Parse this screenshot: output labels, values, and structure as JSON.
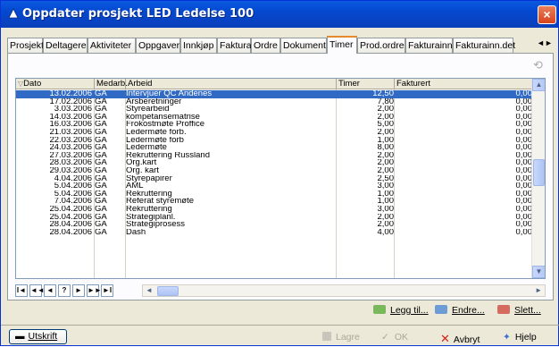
{
  "window": {
    "title": "Oppdater prosjekt LED Ledelse 100",
    "close_label": "×"
  },
  "tabs": [
    {
      "label": "Prosjekt"
    },
    {
      "label": "Deltagere"
    },
    {
      "label": "Aktiviteter"
    },
    {
      "label": "Oppgaver"
    },
    {
      "label": "Innkjøp"
    },
    {
      "label": "Faktura"
    },
    {
      "label": "Ordre"
    },
    {
      "label": "Dokument"
    },
    {
      "label": "Timer"
    },
    {
      "label": "Prod.ordre"
    },
    {
      "label": "Fakturainn"
    },
    {
      "label": "Fakturainn.det"
    }
  ],
  "active_tab": "Timer",
  "tab_nav": {
    "prev": "◄",
    "next": "►"
  },
  "grid": {
    "headers": {
      "dato": "Dato",
      "medarb": "Medarb.",
      "arbeid": "Arbeid",
      "timer": "Timer",
      "fakturert": "Fakturert"
    },
    "rows": [
      {
        "dato": "13.02.2006",
        "medarb": "GA",
        "arbeid": "Intervjuer QC Andenes",
        "timer": "12,50",
        "fakturert": "0,00",
        "selected": true
      },
      {
        "dato": "17.02.2006",
        "medarb": "GA",
        "arbeid": "Årsberetninger",
        "timer": "7,80",
        "fakturert": "0,00"
      },
      {
        "dato": "3.03.2006",
        "medarb": "GA",
        "arbeid": "Styrearbeid",
        "timer": "2,00",
        "fakturert": "0,00"
      },
      {
        "dato": "14.03.2006",
        "medarb": "GA",
        "arbeid": "kompetansematrise",
        "timer": "2,00",
        "fakturert": "0,00"
      },
      {
        "dato": "16.03.2006",
        "medarb": "GA",
        "arbeid": "Frokostmøte Proffice",
        "timer": "5,00",
        "fakturert": "0,00"
      },
      {
        "dato": "21.03.2006",
        "medarb": "GA",
        "arbeid": "Ledermøte forb.",
        "timer": "2,00",
        "fakturert": "0,00"
      },
      {
        "dato": "22.03.2006",
        "medarb": "GA",
        "arbeid": "Ledermøte forb",
        "timer": "1,00",
        "fakturert": "0,00"
      },
      {
        "dato": "24.03.2006",
        "medarb": "GA",
        "arbeid": "Ledermøte",
        "timer": "8,00",
        "fakturert": "0,00"
      },
      {
        "dato": "27.03.2006",
        "medarb": "GA",
        "arbeid": "Rekruttering Russland",
        "timer": "2,00",
        "fakturert": "0,00"
      },
      {
        "dato": "28.03.2006",
        "medarb": "GA",
        "arbeid": "Org.kart",
        "timer": "2,00",
        "fakturert": "0,00"
      },
      {
        "dato": "29.03.2006",
        "medarb": "GA",
        "arbeid": "Org. kart",
        "timer": "2,00",
        "fakturert": "0,00"
      },
      {
        "dato": "4.04.2006",
        "medarb": "GA",
        "arbeid": "Styrepapirer",
        "timer": "2,50",
        "fakturert": "0,00"
      },
      {
        "dato": "5.04.2006",
        "medarb": "GA",
        "arbeid": "AML",
        "timer": "3,00",
        "fakturert": "0,00"
      },
      {
        "dato": "5.04.2006",
        "medarb": "GA",
        "arbeid": "Rekruttering",
        "timer": "1,00",
        "fakturert": "0,00"
      },
      {
        "dato": "7.04.2006",
        "medarb": "GA",
        "arbeid": "Referat styremøte",
        "timer": "1,00",
        "fakturert": "0,00"
      },
      {
        "dato": "25.04.2006",
        "medarb": "GA",
        "arbeid": "Rekruttering",
        "timer": "3,00",
        "fakturert": "0,00"
      },
      {
        "dato": "25.04.2006",
        "medarb": "GA",
        "arbeid": "Strategiplanl.",
        "timer": "2,00",
        "fakturert": "0,00"
      },
      {
        "dato": "28.04.2006",
        "medarb": "GA",
        "arbeid": "Strategiprosess",
        "timer": "2,00",
        "fakturert": "0,00"
      },
      {
        "dato": "28.04.2006",
        "medarb": "GA",
        "arbeid": "Dash",
        "timer": "4,00",
        "fakturert": "0,00"
      }
    ]
  },
  "navigator": {
    "first": "I◄",
    "prev_page": "◄◄",
    "prev": "◄",
    "query": "?",
    "next": "►",
    "next_page": "►►",
    "last": "►I"
  },
  "actions": {
    "add": "Legg til...",
    "edit": "Endre...",
    "delete": "Slett..."
  },
  "bottom": {
    "print": "Utskrift",
    "save": "Lagre",
    "ok": "OK",
    "cancel": "Avbryt",
    "help": "Hjelp"
  },
  "colors": {
    "title_bar": "#0548d0",
    "selection": "#316ac5",
    "active_tab_accent": "#e68b2c",
    "cancel_x": "#d2231a"
  }
}
